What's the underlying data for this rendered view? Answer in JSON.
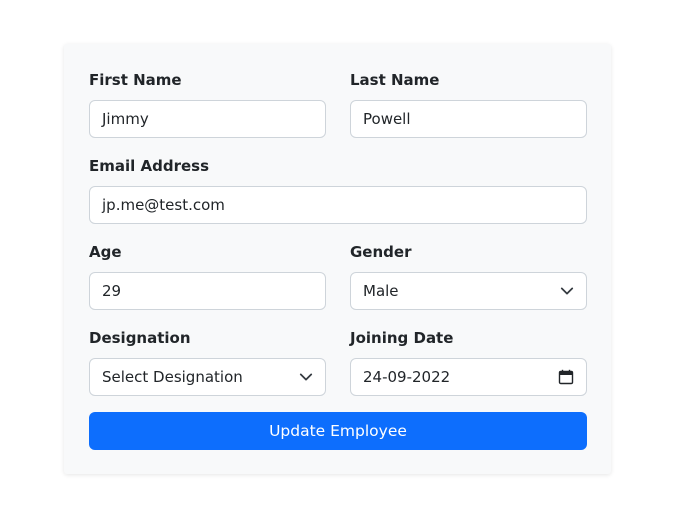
{
  "form": {
    "first_name": {
      "label": "First Name",
      "value": "Jimmy"
    },
    "last_name": {
      "label": "Last Name",
      "value": "Powell"
    },
    "email": {
      "label": "Email Address",
      "value": "jp.me@test.com"
    },
    "age": {
      "label": "Age",
      "value": "29"
    },
    "gender": {
      "label": "Gender",
      "value": "Male",
      "icon": "chevron-down-icon"
    },
    "designation": {
      "label": "Designation",
      "value": "Select Designation",
      "icon": "chevron-down-icon"
    },
    "joining_date": {
      "label": "Joining Date",
      "value": "24-09-2022",
      "icon": "calendar-icon"
    },
    "submit_label": "Update Employee"
  },
  "colors": {
    "primary": "#0d6efd",
    "card_bg": "#f8f9fa",
    "border": "#ced4da",
    "text": "#212529"
  }
}
